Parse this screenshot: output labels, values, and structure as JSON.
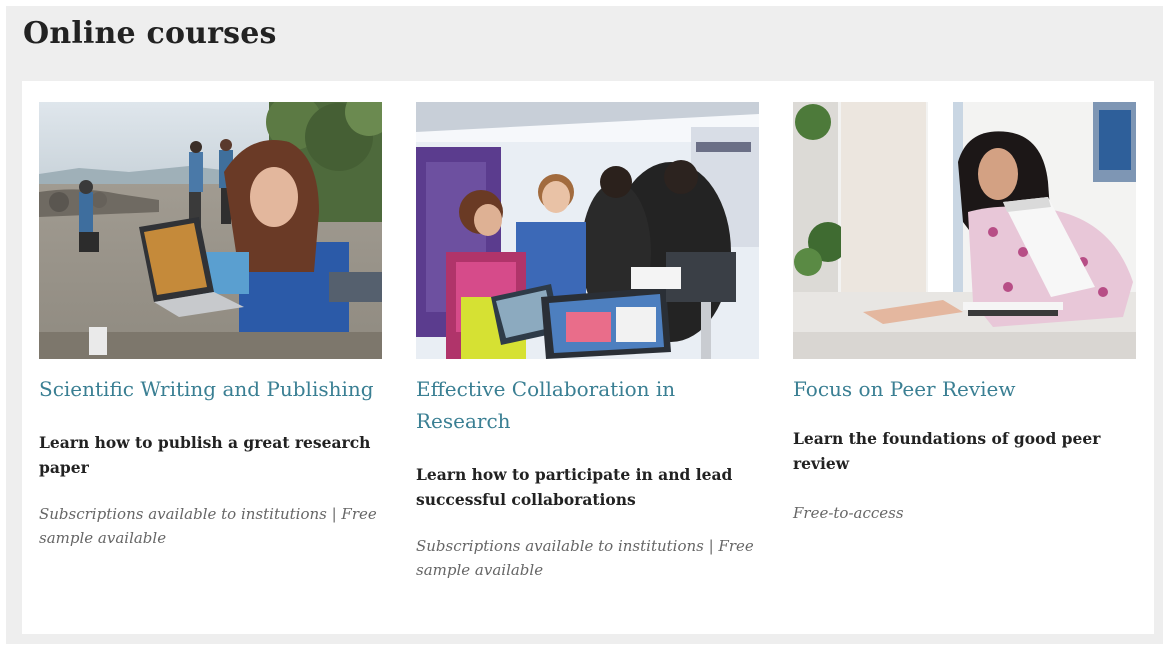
{
  "section": {
    "title": "Online courses"
  },
  "courses": [
    {
      "title": "Scientific Writing and Publishing",
      "description": "Learn how to publish a great research paper",
      "access": "Subscriptions available to institutions | Free sample available",
      "image": "photo-researcher-with-laptop-on-beach"
    },
    {
      "title": "Effective Collaboration in Research",
      "description": "Learn how to participate in and lead successful collaborations",
      "access": "Subscriptions available to institutions | Free sample available",
      "image": "photo-conference-crowd-with-tablets"
    },
    {
      "title": "Focus on Peer Review",
      "description": "Learn the foundations of good peer review",
      "access": "Free-to-access",
      "image": "photo-woman-reviewing-papers"
    }
  ],
  "colors": {
    "link": "#3a7f93",
    "background": "#eeeeee",
    "panel": "#ffffff",
    "heading": "#222222",
    "meta": "#666666"
  }
}
